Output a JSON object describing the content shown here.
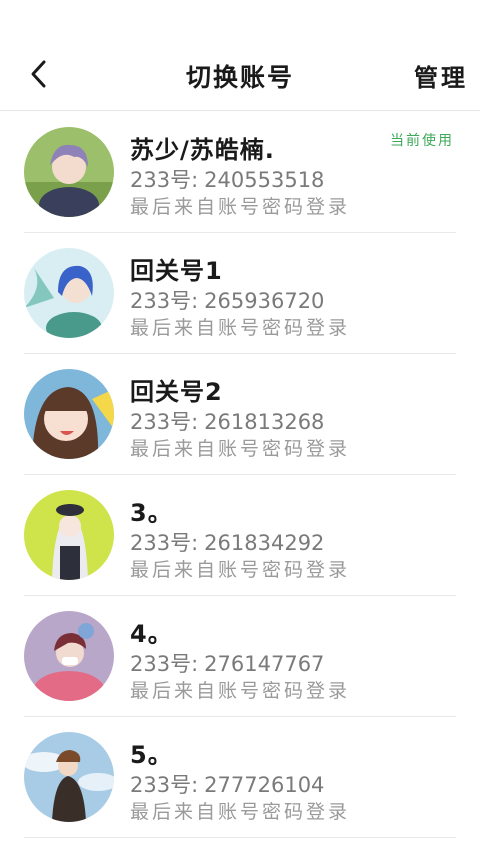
{
  "header": {
    "back_icon": "chevron-left-icon",
    "title": "切换账号",
    "manage_label": "管理"
  },
  "accounts": [
    {
      "name": "苏少/苏皓楠.",
      "id_label": "233号:",
      "id": "240553518",
      "login_method": "最后来自账号密码登录",
      "current_label": "当前使用",
      "avatar_icon": "anime-boy-purple-hair-avatar"
    },
    {
      "name": "回关号1",
      "id_label": "233号:",
      "id": "265936720",
      "login_method": "最后来自账号密码登录",
      "avatar_icon": "anime-boy-blue-hair-avatar"
    },
    {
      "name": "回关号2",
      "id_label": "233号:",
      "id": "261813268",
      "login_method": "最后来自账号密码登录",
      "avatar_icon": "anime-girl-brown-hair-avatar"
    },
    {
      "name": "3。",
      "id_label": "233号:",
      "id": "261834292",
      "login_method": "最后来自账号密码登录",
      "avatar_icon": "anime-girl-white-hair-avatar"
    },
    {
      "name": "4。",
      "id_label": "233号:",
      "id": "276147767",
      "login_method": "最后来自账号密码登录",
      "avatar_icon": "anime-boy-red-hair-avatar"
    },
    {
      "name": "5。",
      "id_label": "233号:",
      "id": "277726104",
      "login_method": "最后来自账号密码登录",
      "avatar_icon": "anime-character-sky-avatar"
    }
  ],
  "colors": {
    "current_label": "#3daa5a",
    "divider": "#e8e8e8",
    "secondary_text": "#7a7a7a"
  }
}
